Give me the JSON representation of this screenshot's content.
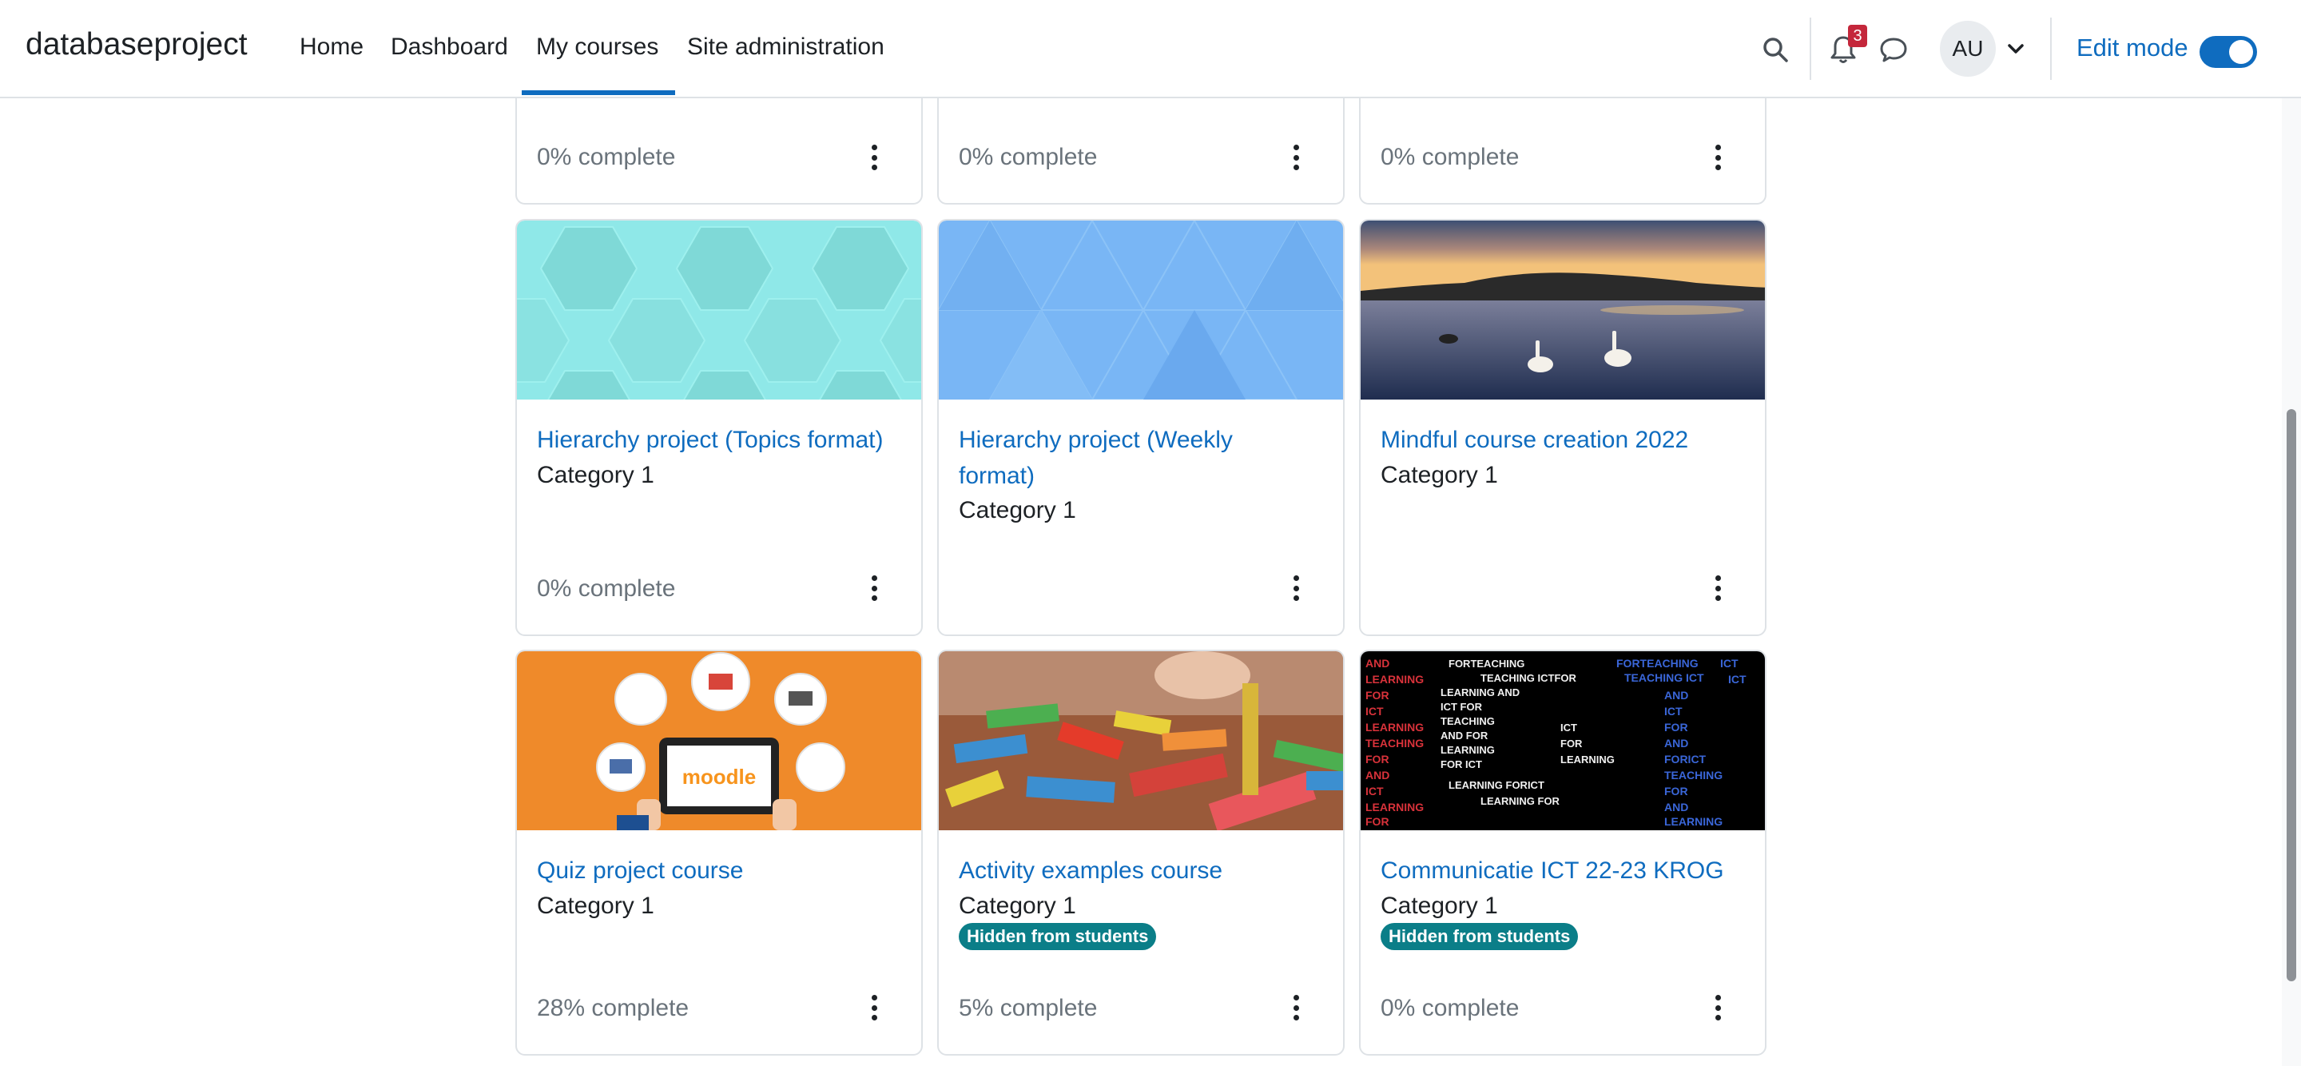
{
  "navbar": {
    "brand": "databaseproject",
    "links": [
      "Home",
      "Dashboard",
      "My courses",
      "Site administration"
    ],
    "active_link": "My courses",
    "notification_count": "3",
    "avatar_initials": "AU",
    "edit_mode_label": "Edit mode",
    "edit_mode_on": true
  },
  "courses_top_row": [
    {
      "progress": "0% complete"
    },
    {
      "progress": "0% complete"
    },
    {
      "progress": "0% complete"
    }
  ],
  "courses": [
    {
      "title": "Hierarchy project (Topics format)",
      "category": "Category 1",
      "progress": "0% complete",
      "image": "teal-hexagon-pattern"
    },
    {
      "title": "Hierarchy project (Weekly format)",
      "category": "Category 1",
      "progress": "",
      "image": "blue-triangle-pattern"
    },
    {
      "title": "Mindful course creation 2022",
      "category": "Category 1",
      "progress": "",
      "image": "lake-with-swans-photo"
    },
    {
      "title": "Quiz project course",
      "category": "Category 1",
      "progress": "28% complete",
      "image": "moodle-tablet-illustration"
    },
    {
      "title": "Activity examples course",
      "category": "Category 1",
      "badge": "Hidden from students",
      "progress": "5% complete",
      "image": "wooden-blocks-photo"
    },
    {
      "title": "Communicatie ICT 22-23 KROG",
      "category": "Category 1",
      "badge": "Hidden from students",
      "progress": "0% complete",
      "image": "ict-word-cloud"
    }
  ],
  "colors": {
    "link": "#0f6cbf",
    "badge": "#0b7e88",
    "notification": "#c4273b"
  }
}
